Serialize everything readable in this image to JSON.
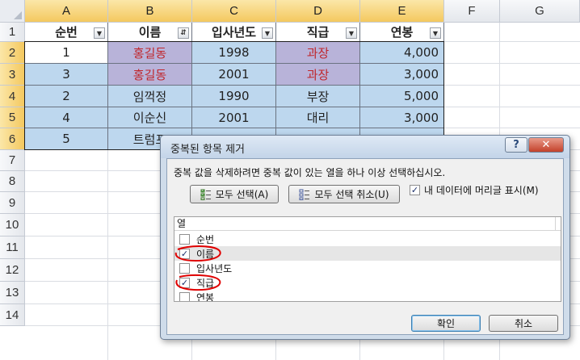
{
  "columns": [
    "A",
    "B",
    "C",
    "D",
    "E",
    "F",
    "G"
  ],
  "rows": [
    "1",
    "2",
    "3",
    "4",
    "5",
    "6",
    "7",
    "8",
    "9",
    "10",
    "11",
    "12",
    "13",
    "14"
  ],
  "table": {
    "headers": [
      "순번",
      "이름",
      "입사년도",
      "직급",
      "연봉"
    ],
    "rows": [
      [
        "1",
        "홍길동",
        "1998",
        "과장",
        "4,000"
      ],
      [
        "3",
        "홍길동",
        "2001",
        "과장",
        "3,000"
      ],
      [
        "2",
        "임꺽정",
        "1990",
        "부장",
        "5,000"
      ],
      [
        "4",
        "이순신",
        "2001",
        "대리",
        "3,000"
      ],
      [
        "5",
        "트럼프",
        "",
        "",
        ""
      ]
    ]
  },
  "dialog": {
    "title": "중복된 항목 제거",
    "help_label": "?",
    "close_label": "✕",
    "instruction": "중복 값을 삭제하려면 중복 값이 있는 열을 하나 이상 선택하십시오.",
    "select_all_label": "모두 선택(A)",
    "unselect_all_label": "모두 선택 취소(U)",
    "header_checkbox_label": "내 데이터에 머리글 표시(M)",
    "header_checkbox_checked": true,
    "list_header": "열",
    "columns": [
      {
        "label": "순번",
        "checked": false
      },
      {
        "label": "이름",
        "checked": true
      },
      {
        "label": "입사년도",
        "checked": false
      },
      {
        "label": "직급",
        "checked": true
      },
      {
        "label": "연봉",
        "checked": false
      }
    ],
    "ok_label": "확인",
    "cancel_label": "취소"
  },
  "colors": {
    "selected_header": "#f4c85f",
    "blue_fill": "#bdd7ee",
    "purple_fill": "#b8b3d9",
    "duplicate_text": "#c0272d",
    "annotation": "#e00000"
  },
  "icons": {
    "select_all": "checklist-icon",
    "unselect_all": "unchecklist-icon",
    "filter": "filter-dropdown-icon"
  }
}
